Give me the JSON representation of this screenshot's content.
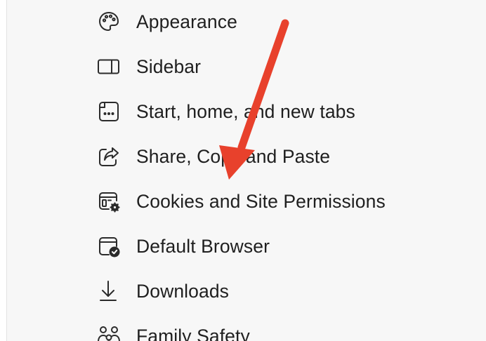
{
  "settings_menu": {
    "items": [
      {
        "label": "Appearance",
        "icon": "palette-icon"
      },
      {
        "label": "Sidebar",
        "icon": "sidebar-icon"
      },
      {
        "label": "Start, home, and new tabs",
        "icon": "new-tab-icon"
      },
      {
        "label": "Share, Copy and Paste",
        "icon": "share-icon"
      },
      {
        "label": "Cookies and Site Permissions",
        "icon": "site-permissions-icon"
      },
      {
        "label": "Default Browser",
        "icon": "default-browser-icon"
      },
      {
        "label": "Downloads",
        "icon": "download-icon"
      },
      {
        "label": "Family Safety",
        "icon": "family-icon"
      }
    ]
  },
  "annotation": {
    "arrow_color": "#e8412c"
  }
}
